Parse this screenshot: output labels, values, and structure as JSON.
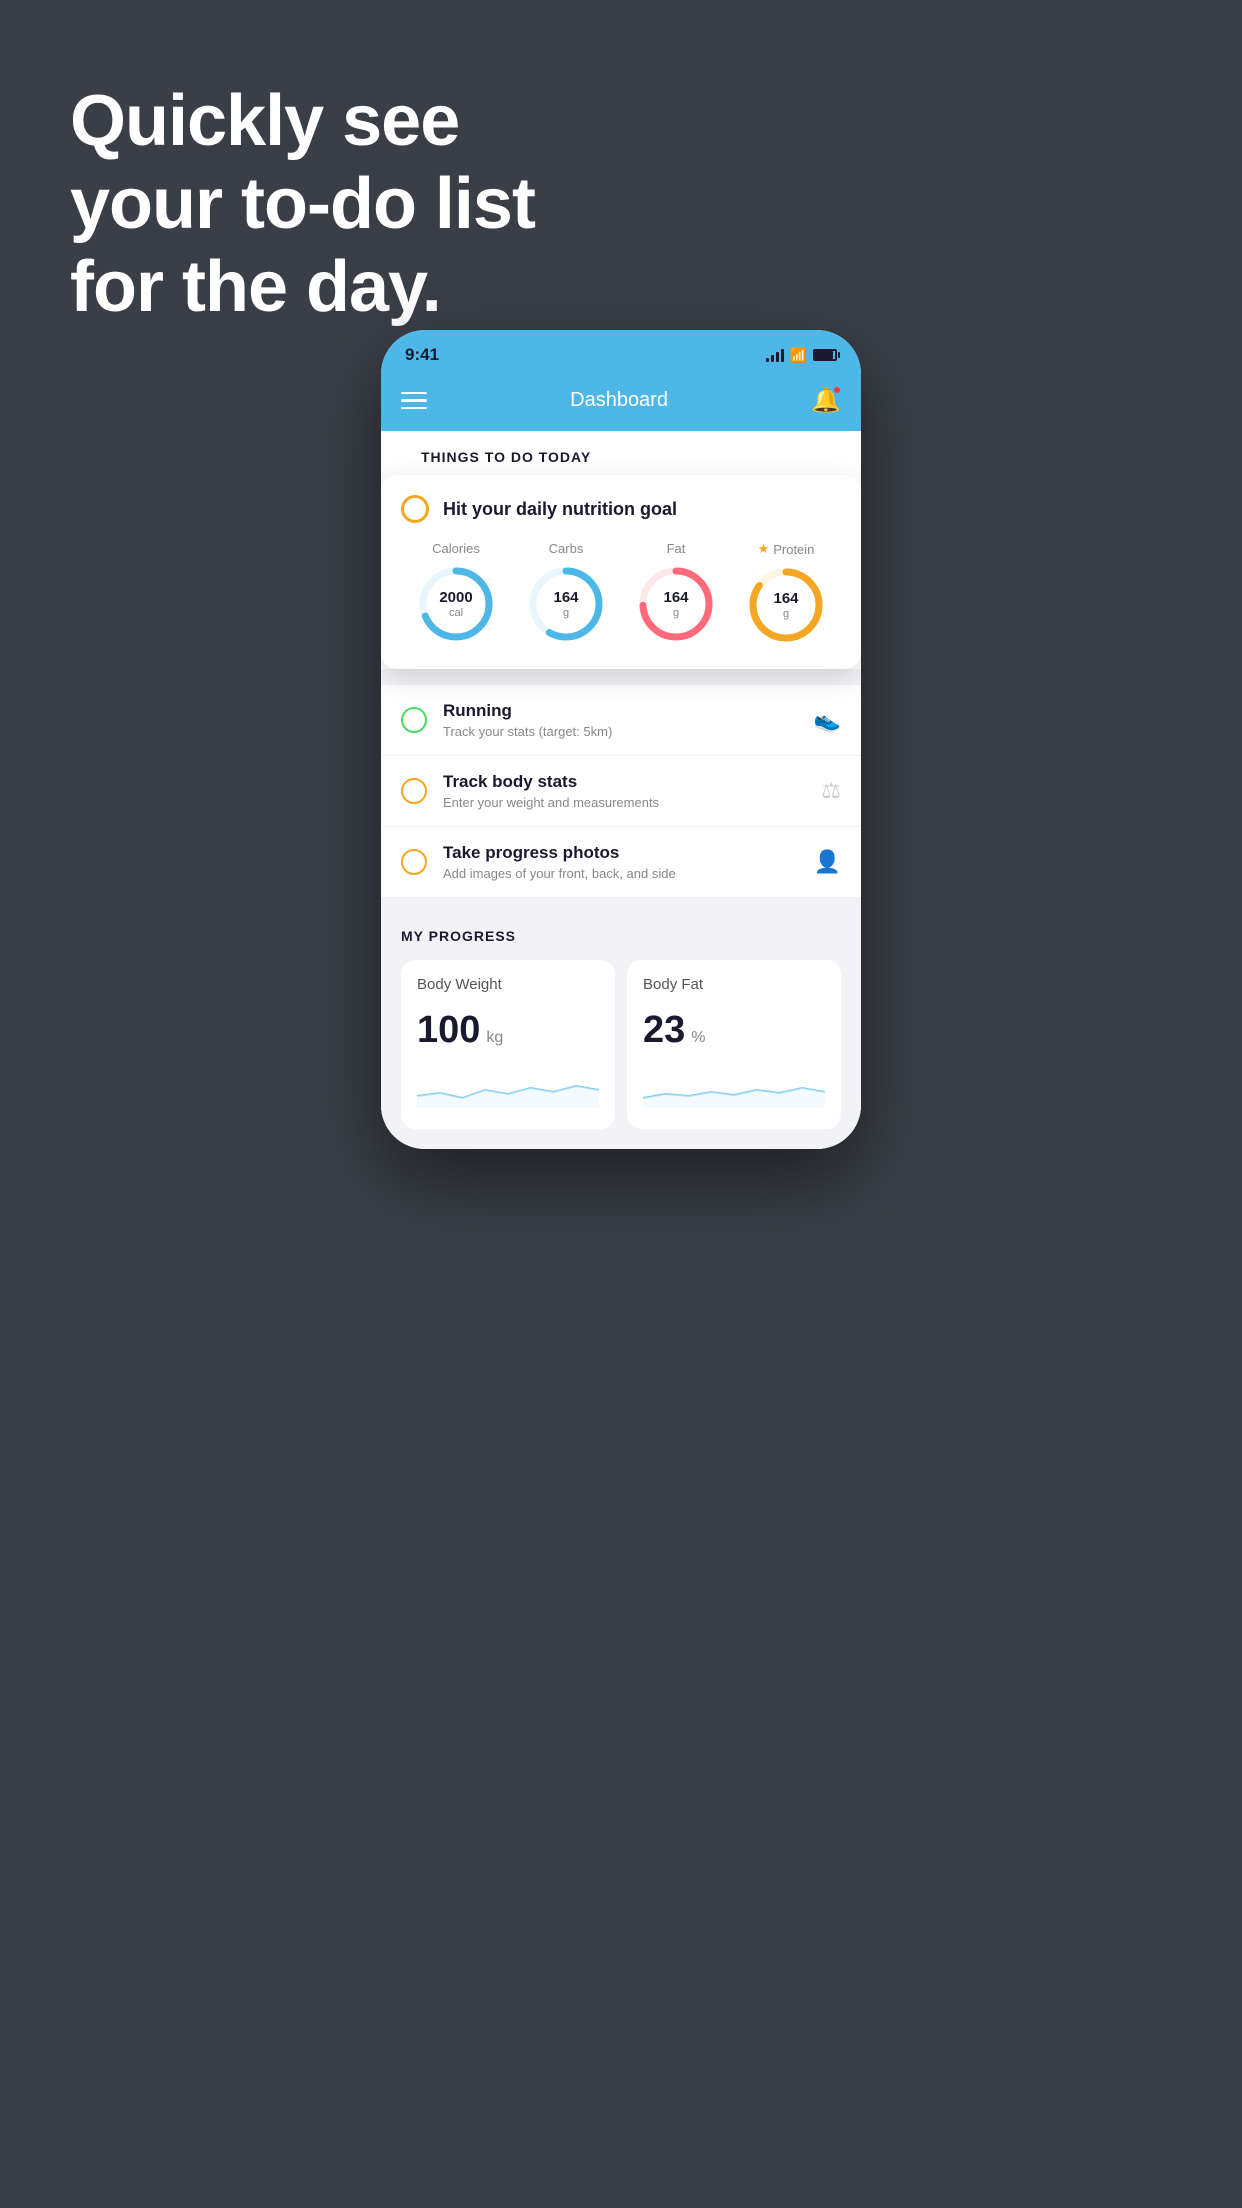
{
  "background_color": "#3a3f47",
  "hero": {
    "line1": "Quickly see",
    "line2": "your to-do list",
    "line3": "for the day."
  },
  "status_bar": {
    "time": "9:41"
  },
  "nav": {
    "title": "Dashboard"
  },
  "things_today": {
    "section_title": "THINGS TO DO TODAY"
  },
  "nutrition_card": {
    "title": "Hit your daily nutrition goal",
    "metrics": [
      {
        "label": "Calories",
        "value": "2000",
        "unit": "cal",
        "color": "#4db8e8",
        "bg_color": "#e8f7fd",
        "percent": 65,
        "circumference": 220,
        "star": false
      },
      {
        "label": "Carbs",
        "value": "164",
        "unit": "g",
        "color": "#4db8e8",
        "bg_color": "#e8f7fd",
        "percent": 55,
        "circumference": 220,
        "star": false
      },
      {
        "label": "Fat",
        "value": "164",
        "unit": "g",
        "color": "#ff6b7a",
        "bg_color": "#ffe8ea",
        "percent": 70,
        "circumference": 220,
        "star": false
      },
      {
        "label": "Protein",
        "value": "164",
        "unit": "g",
        "color": "#f5a623",
        "bg_color": "#fff5e0",
        "percent": 80,
        "circumference": 220,
        "star": true
      }
    ]
  },
  "todo_items": [
    {
      "title": "Running",
      "subtitle": "Track your stats (target: 5km)",
      "circle_type": "green",
      "icon": "shoe"
    },
    {
      "title": "Track body stats",
      "subtitle": "Enter your weight and measurements",
      "circle_type": "yellow",
      "icon": "scale"
    },
    {
      "title": "Take progress photos",
      "subtitle": "Add images of your front, back, and side",
      "circle_type": "yellow",
      "icon": "person"
    }
  ],
  "progress": {
    "section_title": "MY PROGRESS",
    "cards": [
      {
        "title": "Body Weight",
        "value": "100",
        "unit": "kg"
      },
      {
        "title": "Body Fat",
        "value": "23",
        "unit": "%"
      }
    ]
  }
}
